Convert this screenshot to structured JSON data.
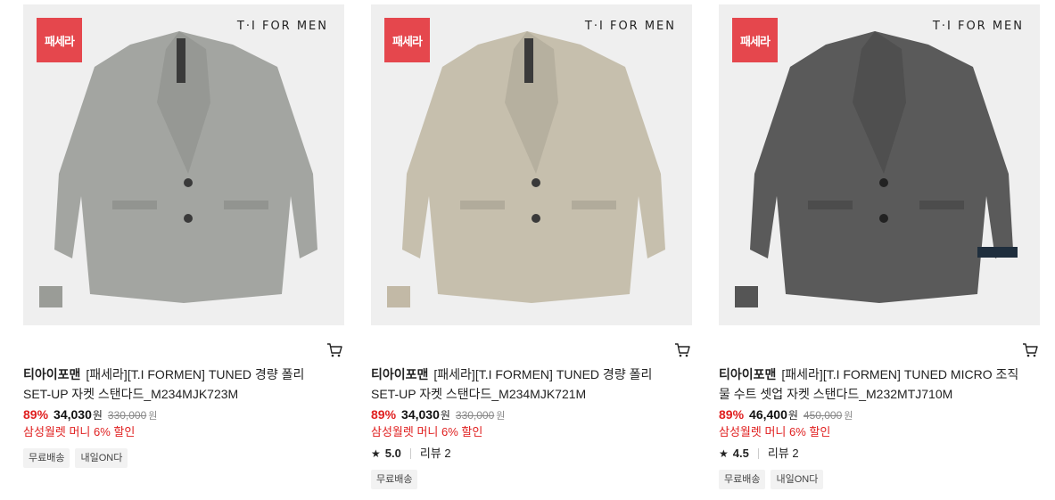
{
  "products": [
    {
      "badge": "패세라",
      "brand_mark": "T·I FOR MEN",
      "swatch_color": "#9a9c97",
      "jacket_color": "#a3a5a1",
      "brand": "티아이포맨",
      "name": "[패세라][T.I FORMEN] TUNED 경량 폴리 SET-UP 자켓 스탠다드_M234MJK723M",
      "discount": "89%",
      "price": "34,030",
      "price_unit": "원",
      "original_price": "330,000",
      "original_unit": "원",
      "benefit": "삼성월렛 머니 6% 할인",
      "rating": null,
      "reviews": null,
      "tags": [
        "무료배송",
        "내일ON다"
      ]
    },
    {
      "badge": "패세라",
      "brand_mark": "T·I FOR MEN",
      "swatch_color": "#c2b9a6",
      "jacket_color": "#c6bfad",
      "brand": "티아이포맨",
      "name": "[패세라][T.I FORMEN] TUNED 경량 폴리 SET-UP 자켓 스탠다드_M234MJK721M",
      "discount": "89%",
      "price": "34,030",
      "price_unit": "원",
      "original_price": "330,000",
      "original_unit": "원",
      "benefit": "삼성월렛 머니 6% 할인",
      "rating": "5.0",
      "reviews": "리뷰 2",
      "tags": [
        "무료배송"
      ]
    },
    {
      "badge": "패세라",
      "brand_mark": "T·I FOR MEN",
      "swatch_color": "#555555",
      "jacket_color": "#5a5a5a",
      "brand": "티아이포맨",
      "name": "[패세라][T.I FORMEN] TUNED MICRO 조직물 수트 셋업 자켓 스탠다드_M232MTJ710M",
      "discount": "89%",
      "price": "46,400",
      "price_unit": "원",
      "original_price": "450,000",
      "original_unit": "원",
      "benefit": "삼성월렛 머니 6% 할인",
      "rating": "4.5",
      "reviews": "리뷰 2",
      "tags": [
        "무료배송",
        "내일ON다"
      ]
    }
  ],
  "icons": {
    "cart": "cart-icon",
    "star": "star-icon"
  }
}
